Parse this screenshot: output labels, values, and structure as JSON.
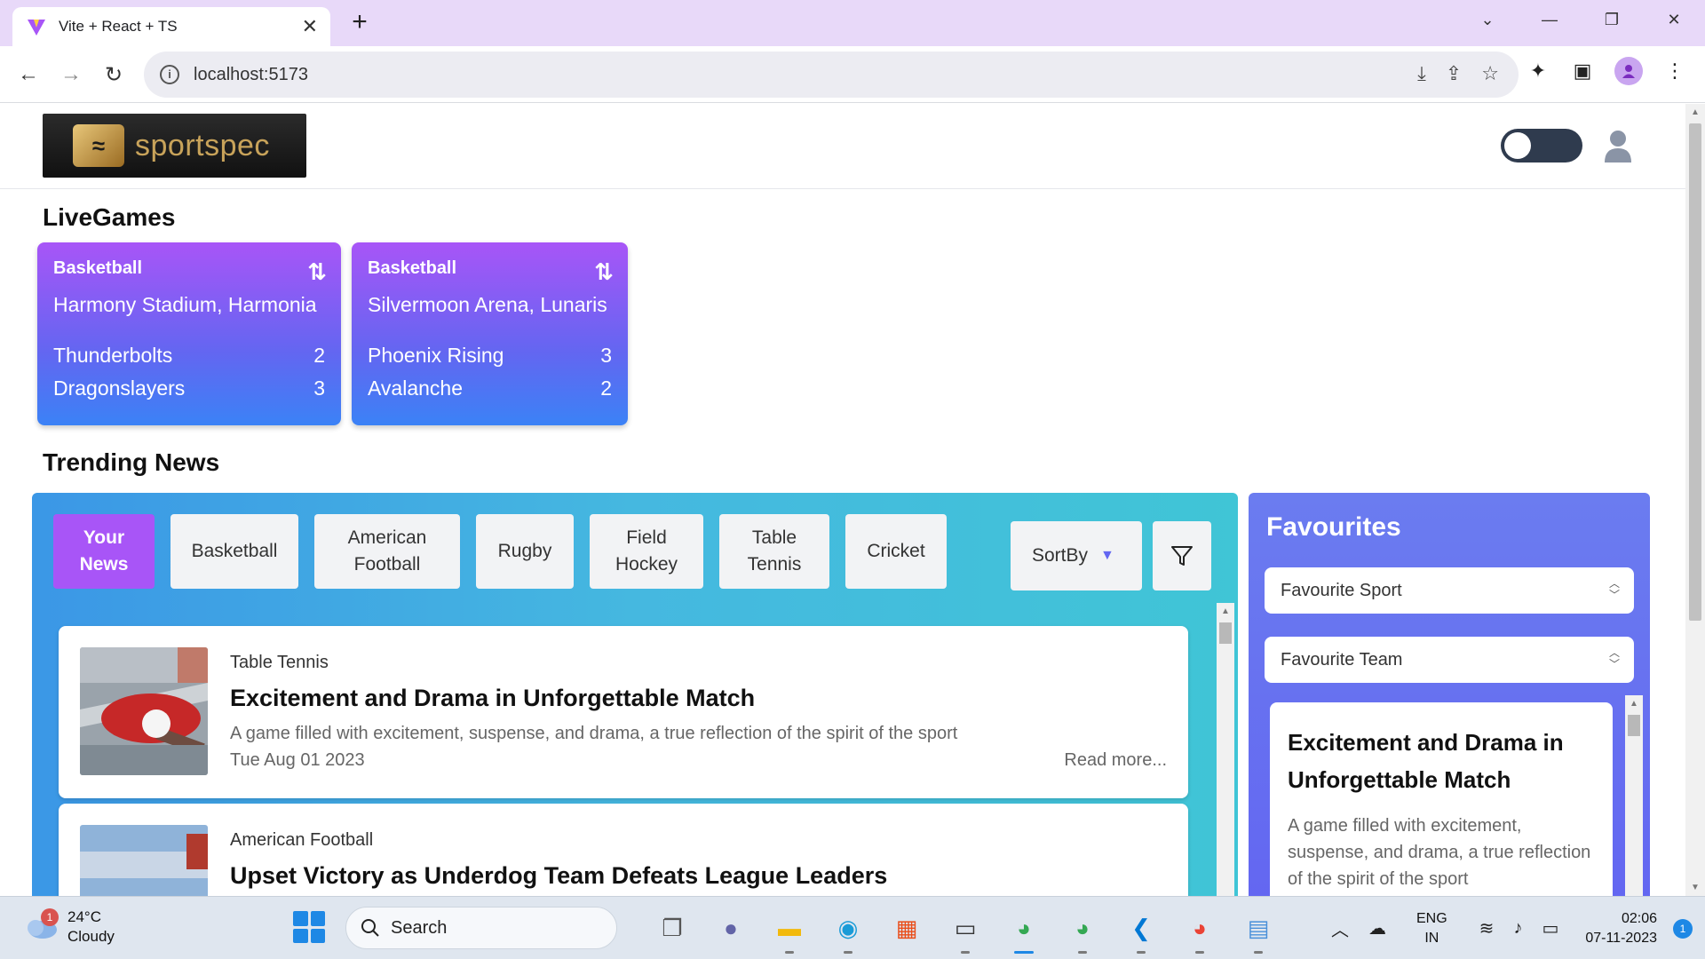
{
  "browser": {
    "tab_title": "Vite + React + TS",
    "url": "localhost:5173"
  },
  "header": {
    "logo_text": "sportspec"
  },
  "live_games": {
    "title": "LiveGames",
    "games": [
      {
        "sport": "Basketball",
        "venue": "Harmony Stadium, Harmonia",
        "team1": "Thunderbolts",
        "score1": "2",
        "team2": "Dragonslayers",
        "score2": "3"
      },
      {
        "sport": "Basketball",
        "venue": "Silvermoon Arena, Lunaris",
        "team1": "Phoenix Rising",
        "score1": "3",
        "team2": "Avalanche",
        "score2": "2"
      }
    ]
  },
  "trending": {
    "title": "Trending News",
    "filters": [
      "Your News",
      "Basketball",
      "American Football",
      "Rugby",
      "Field Hockey",
      "Table Tennis",
      "Cricket"
    ],
    "sort_label": "SortBy",
    "articles": [
      {
        "category": "Table Tennis",
        "headline": "Excitement and Drama in Unforgettable Match",
        "description": "A game filled with excitement, suspense, and drama, a true reflection of the spirit of the sport",
        "date": "Tue Aug 01 2023",
        "read_more": "Read more..."
      },
      {
        "category": "American Football",
        "headline": "Upset Victory as Underdog Team Defeats League Leaders"
      }
    ]
  },
  "favourites": {
    "title": "Favourites",
    "sport_select": "Favourite Sport",
    "team_select": "Favourite Team",
    "card_headline": "Excitement and Drama in Unforgettable Match",
    "card_description": "A game filled with excitement, suspense, and drama, a true reflection of the spirit of the sport"
  },
  "taskbar": {
    "weather_temp": "24°C",
    "weather_desc": "Cloudy",
    "weather_badge": "1",
    "search_label": "Search",
    "lang_1": "ENG",
    "lang_2": "IN",
    "time": "02:06",
    "date": "07-11-2023",
    "notifications": "1"
  },
  "colors": {
    "accent_purple": "#a855f7",
    "accent_blue": "#3b82f6",
    "news_panel": "#45b8e0",
    "favourites_panel": "#6366f1"
  }
}
